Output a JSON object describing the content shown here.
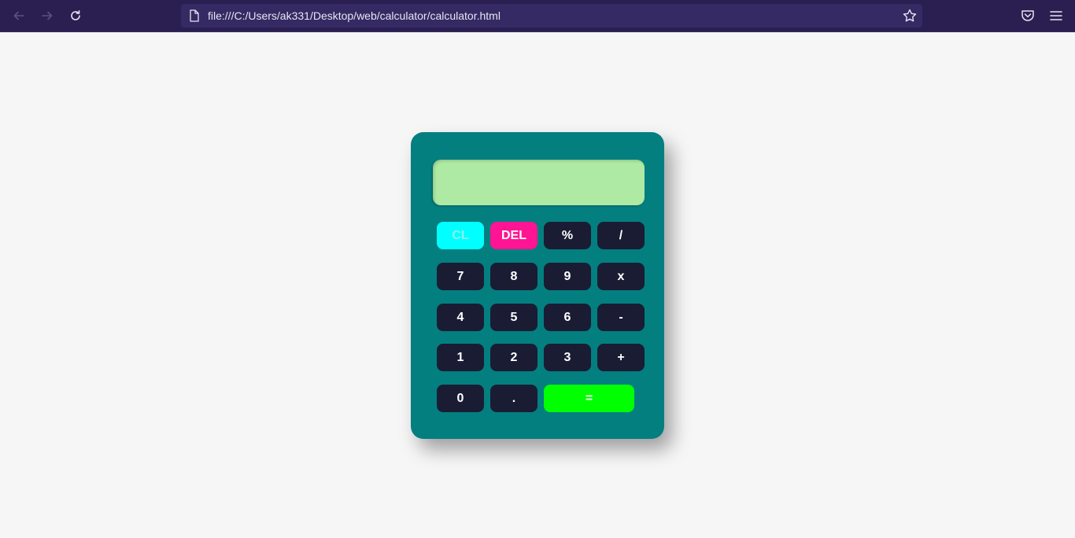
{
  "browser": {
    "url": "file:///C:/Users/ak331/Desktop/web/calculator/calculator.html"
  },
  "calculator": {
    "display_value": "",
    "keys": {
      "clear": "CL",
      "delete": "DEL",
      "percent": "%",
      "divide": "/",
      "seven": "7",
      "eight": "8",
      "nine": "9",
      "multiply": "x",
      "four": "4",
      "five": "5",
      "six": "6",
      "minus": "-",
      "one": "1",
      "two": "2",
      "three": "3",
      "plus": "+",
      "zero": "0",
      "decimal": ".",
      "equals": "="
    }
  },
  "colors": {
    "body_bg": "#037f80",
    "display_bg": "#aeeaa3",
    "key_bg": "#1a1c34",
    "clear_bg": "#00ffff",
    "delete_bg": "#ff1493",
    "equals_bg": "#00ff00",
    "toolbar_bg": "#2b1f52"
  }
}
